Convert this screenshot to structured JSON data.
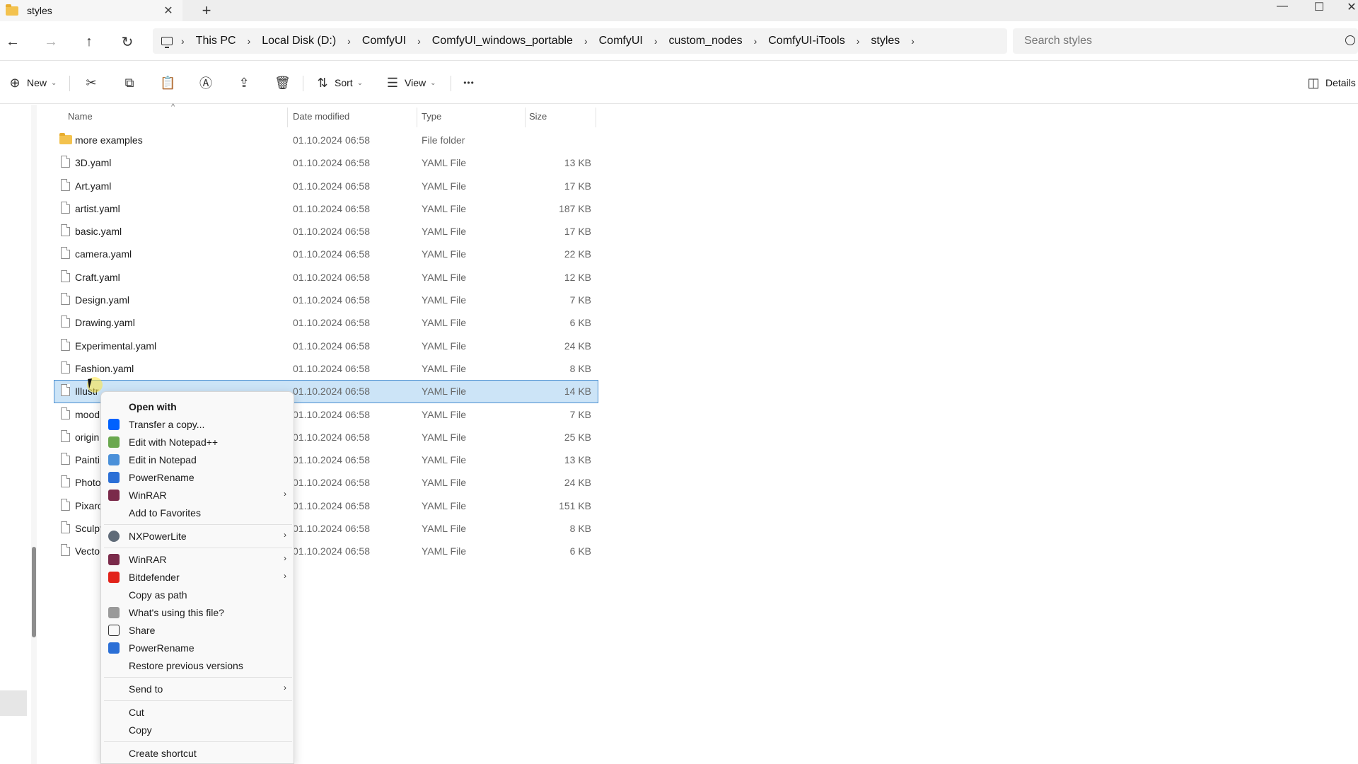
{
  "tab": {
    "title": "styles",
    "close_glyph": "✕",
    "add_glyph": "+"
  },
  "window_controls": {
    "minimize": "—",
    "maximize": "☐",
    "close": "✕"
  },
  "nav": {
    "back": "←",
    "forward": "→",
    "up": "↑",
    "refresh": "↻"
  },
  "breadcrumbs": [
    "This PC",
    "Local Disk (D:)",
    "ComfyUI",
    "ComfyUI_windows_portable",
    "ComfyUI",
    "custom_nodes",
    "ComfyUI-iTools",
    "styles"
  ],
  "search": {
    "placeholder": "Search styles"
  },
  "toolbar": {
    "new_label": "New",
    "sort_label": "Sort",
    "view_label": "View",
    "more_glyph": "•••",
    "details_label": "Details"
  },
  "columns": {
    "name": "Name",
    "date": "Date modified",
    "type": "Type",
    "size": "Size"
  },
  "files": [
    {
      "name": "more examples",
      "date": "01.10.2024 06:58",
      "type": "File folder",
      "size": "",
      "kind": "folder"
    },
    {
      "name": "3D.yaml",
      "date": "01.10.2024 06:58",
      "type": "YAML File",
      "size": "13 KB",
      "kind": "file"
    },
    {
      "name": "Art.yaml",
      "date": "01.10.2024 06:58",
      "type": "YAML File",
      "size": "17 KB",
      "kind": "file"
    },
    {
      "name": "artist.yaml",
      "date": "01.10.2024 06:58",
      "type": "YAML File",
      "size": "187 KB",
      "kind": "file"
    },
    {
      "name": "basic.yaml",
      "date": "01.10.2024 06:58",
      "type": "YAML File",
      "size": "17 KB",
      "kind": "file"
    },
    {
      "name": "camera.yaml",
      "date": "01.10.2024 06:58",
      "type": "YAML File",
      "size": "22 KB",
      "kind": "file"
    },
    {
      "name": "Craft.yaml",
      "date": "01.10.2024 06:58",
      "type": "YAML File",
      "size": "12 KB",
      "kind": "file"
    },
    {
      "name": "Design.yaml",
      "date": "01.10.2024 06:58",
      "type": "YAML File",
      "size": "7 KB",
      "kind": "file"
    },
    {
      "name": "Drawing.yaml",
      "date": "01.10.2024 06:58",
      "type": "YAML File",
      "size": "6 KB",
      "kind": "file"
    },
    {
      "name": "Experimental.yaml",
      "date": "01.10.2024 06:58",
      "type": "YAML File",
      "size": "24 KB",
      "kind": "file"
    },
    {
      "name": "Fashion.yaml",
      "date": "01.10.2024 06:58",
      "type": "YAML File",
      "size": "8 KB",
      "kind": "file"
    },
    {
      "name": "Illustr",
      "date": "01.10.2024 06:58",
      "type": "YAML File",
      "size": "14 KB",
      "kind": "file",
      "selected": true
    },
    {
      "name": "mood",
      "date": "01.10.2024 06:58",
      "type": "YAML File",
      "size": "7 KB",
      "kind": "file"
    },
    {
      "name": "origin",
      "date": "01.10.2024 06:58",
      "type": "YAML File",
      "size": "25 KB",
      "kind": "file"
    },
    {
      "name": "Paintir",
      "date": "01.10.2024 06:58",
      "type": "YAML File",
      "size": "13 KB",
      "kind": "file"
    },
    {
      "name": "Photo",
      "date": "01.10.2024 06:58",
      "type": "YAML File",
      "size": "24 KB",
      "kind": "file"
    },
    {
      "name": "Pixaro",
      "date": "01.10.2024 06:58",
      "type": "YAML File",
      "size": "151 KB",
      "kind": "file"
    },
    {
      "name": "Sculpt",
      "date": "01.10.2024 06:58",
      "type": "YAML File",
      "size": "8 KB",
      "kind": "file"
    },
    {
      "name": "Vector",
      "date": "01.10.2024 06:58",
      "type": "YAML File",
      "size": "6 KB",
      "kind": "file"
    }
  ],
  "context_menu": {
    "items": [
      {
        "label": "Open with",
        "icon": "",
        "bold": true,
        "submenu": false
      },
      {
        "label": "Transfer a copy...",
        "icon": "dropbox-icon",
        "submenu": false
      },
      {
        "label": "Edit with Notepad++",
        "icon": "notepad-plus-plus-icon",
        "submenu": false
      },
      {
        "label": "Edit in Notepad",
        "icon": "notepad-icon",
        "submenu": false
      },
      {
        "label": "PowerRename",
        "icon": "powerrename-icon",
        "submenu": false
      },
      {
        "label": "WinRAR",
        "icon": "winrar-icon",
        "submenu": true
      },
      {
        "label": "Add to Favorites",
        "icon": "",
        "submenu": false
      },
      {
        "label": "NXPowerLite",
        "icon": "nxpowerlite-icon",
        "submenu": true
      },
      {
        "label": "WinRAR",
        "icon": "winrar-icon",
        "submenu": true
      },
      {
        "label": "Bitdefender",
        "icon": "bitdefender-icon",
        "submenu": true
      },
      {
        "label": "Copy as path",
        "icon": "",
        "submenu": false
      },
      {
        "label": "What's using this file?",
        "icon": "lock-icon",
        "submenu": false
      },
      {
        "label": "Share",
        "icon": "share-icon",
        "submenu": false
      },
      {
        "label": "PowerRename",
        "icon": "powerrename-icon",
        "submenu": false
      },
      {
        "label": "Restore previous versions",
        "icon": "",
        "submenu": false
      },
      {
        "label": "Send to",
        "icon": "",
        "submenu": true
      },
      {
        "label": "Cut",
        "icon": "",
        "submenu": false
      },
      {
        "label": "Copy",
        "icon": "",
        "submenu": false
      },
      {
        "label": "Create shortcut",
        "icon": "",
        "submenu": false
      }
    ],
    "submenu_arrow": "›"
  },
  "colors": {
    "selection": "#cce4f7",
    "selection_border": "#4b8fd1",
    "folder": "#f3c24e",
    "dropbox": "#0061fe",
    "bitdefender": "#e2231a",
    "winrar": "#7a2a4a",
    "powerrename": "#2b6fd6"
  }
}
